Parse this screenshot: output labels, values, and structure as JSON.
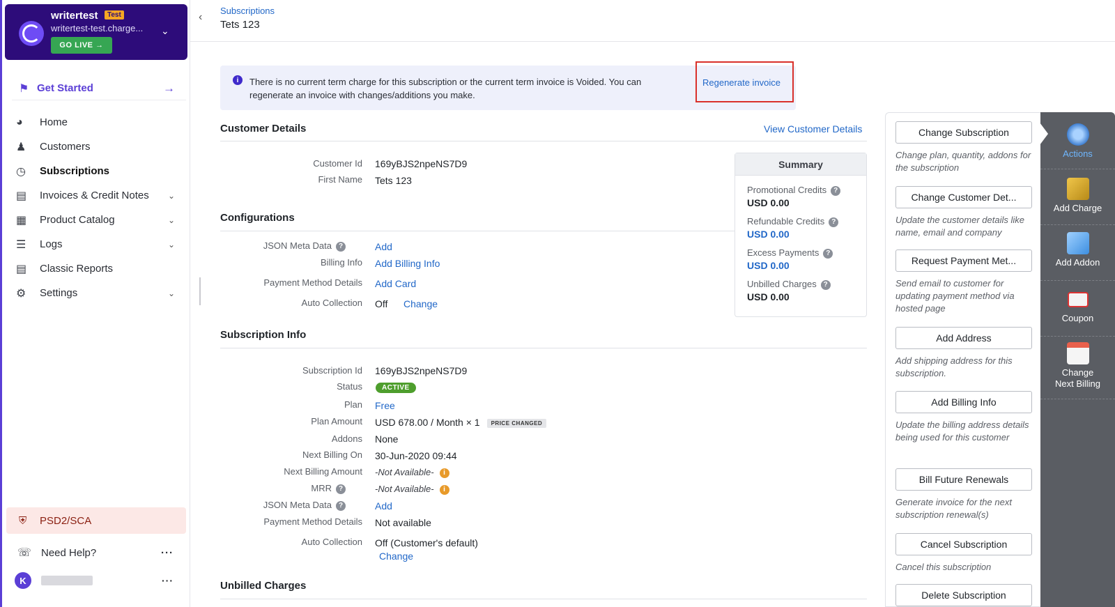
{
  "site": {
    "name": "writertest",
    "badge": "Test",
    "domain": "writertest-test.charge...",
    "go_live": "GO LIVE"
  },
  "sidebar": {
    "get_started": "Get Started",
    "items": [
      {
        "label": "Home",
        "icon": "gauge-icon"
      },
      {
        "label": "Customers",
        "icon": "users-icon"
      },
      {
        "label": "Subscriptions",
        "icon": "subscriptions-icon"
      },
      {
        "label": "Invoices & Credit Notes",
        "icon": "invoice-icon"
      },
      {
        "label": "Product Catalog",
        "icon": "catalog-icon"
      },
      {
        "label": "Logs",
        "icon": "logs-icon"
      },
      {
        "label": "Classic Reports",
        "icon": "report-icon"
      },
      {
        "label": "Settings",
        "icon": "gear-icon"
      }
    ],
    "psd2": "PSD2/SCA",
    "help": "Need Help?",
    "user_initial": "K"
  },
  "header": {
    "breadcrumb": "Subscriptions",
    "title": "Tets 123"
  },
  "banner": {
    "message": "There is no current term charge for this subscription or the current term invoice is Voided. You can regenerate an invoice with changes/additions you make.",
    "link": "Regenerate invoice"
  },
  "customer_details": {
    "title": "Customer Details",
    "view_link": "View Customer Details",
    "customer_id_label": "Customer Id",
    "customer_id": "169yBJS2npeNS7D9",
    "first_name_label": "First Name",
    "first_name": "Tets 123"
  },
  "configurations": {
    "title": "Configurations",
    "json_label": "JSON Meta Data",
    "json_action": "Add",
    "billing_label": "Billing Info",
    "billing_action": "Add Billing Info",
    "payment_label": "Payment Method Details",
    "payment_action": "Add Card",
    "auto_label": "Auto Collection",
    "auto_value": "Off",
    "auto_action": "Change"
  },
  "summary": {
    "title": "Summary",
    "promo_label": "Promotional Credits",
    "promo_value": "USD 0.00",
    "refund_label": "Refundable Credits",
    "refund_value": "USD 0.00",
    "excess_label": "Excess Payments",
    "excess_value": "USD 0.00",
    "unbilled_label": "Unbilled Charges",
    "unbilled_value": "USD 0.00"
  },
  "subscription_info": {
    "title": "Subscription Info",
    "id_label": "Subscription Id",
    "id": "169yBJS2npeNS7D9",
    "status_label": "Status",
    "status": "ACTIVE",
    "plan_label": "Plan",
    "plan": "Free",
    "amount_label": "Plan Amount",
    "amount": "USD 678.00 / Month × 1",
    "price_changed": "PRICE CHANGED",
    "addons_label": "Addons",
    "addons": "None",
    "next_billing_label": "Next Billing On",
    "next_billing": "30-Jun-2020 09:44",
    "next_amount_label": "Next Billing Amount",
    "next_amount": "-Not Available-",
    "mrr_label": "MRR",
    "mrr": "-Not Available-",
    "json_label": "JSON Meta Data",
    "json_action": "Add",
    "payment_label": "Payment Method Details",
    "payment": "Not available",
    "auto_label": "Auto Collection",
    "auto_value": "Off (Customer's default)",
    "auto_action": "Change"
  },
  "unbilled": {
    "title": "Unbilled Charges"
  },
  "actions": [
    {
      "label": "Change Subscription",
      "desc": "Change plan, quantity, addons for the subscription"
    },
    {
      "label": "Change Customer Det...",
      "desc": "Update the customer details like name, email and company"
    },
    {
      "label": "Request Payment Met...",
      "desc": "Send email to customer for updating payment method via hosted page"
    },
    {
      "label": "Add Address",
      "desc": "Add shipping address for this subscription."
    },
    {
      "label": "Add Billing Info",
      "desc": "Update the billing address details being used for this customer"
    },
    {
      "label": "Bill Future Renewals",
      "desc": "Generate invoice for the next subscription renewal(s)"
    },
    {
      "label": "Cancel Subscription",
      "desc": "Cancel this subscription"
    },
    {
      "label": "Delete Subscription",
      "desc": ""
    }
  ],
  "rail": [
    {
      "label": "Actions",
      "icon": "gear-icon"
    },
    {
      "label": "Add Charge",
      "icon": "coins-icon"
    },
    {
      "label": "Add Addon",
      "icon": "cube-icon"
    },
    {
      "label": "Coupon",
      "icon": "coupon-icon"
    },
    {
      "label": "Change Next Billing",
      "icon": "calendar-icon"
    }
  ],
  "colors": {
    "brand": "#2d0c7a",
    "accent": "#5b3fd6",
    "link": "#2268c8",
    "active": "#4e9e2d"
  }
}
